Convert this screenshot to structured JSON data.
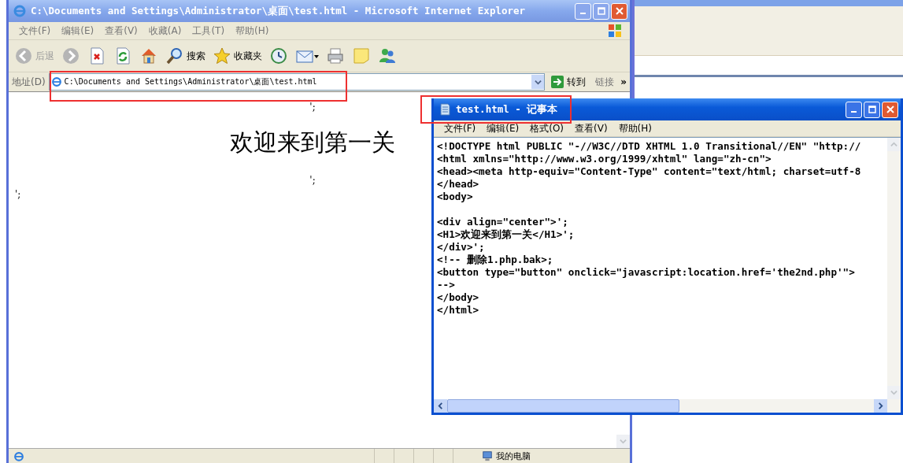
{
  "browser": {
    "title": "C:\\Documents and Settings\\Administrator\\桌面\\test.html - Microsoft Internet Explorer",
    "menu": [
      "文件(F)",
      "编辑(E)",
      "查看(V)",
      "收藏(A)",
      "工具(T)",
      "帮助(H)"
    ],
    "toolbar": [
      {
        "kind": "back",
        "label": "后退",
        "disabled": true
      },
      {
        "kind": "forward",
        "disabled": true
      },
      {
        "kind": "stop"
      },
      {
        "kind": "refresh"
      },
      {
        "kind": "home"
      },
      {
        "kind": "search",
        "label": "搜索"
      },
      {
        "kind": "favorites",
        "label": "收藏夹"
      },
      {
        "kind": "history"
      },
      {
        "kind": "mail"
      },
      {
        "kind": "print"
      },
      {
        "kind": "note"
      },
      {
        "kind": "messenger"
      }
    ],
    "address_label": "地址(D)",
    "address": "C:\\Documents and Settings\\Administrator\\桌面\\test.html",
    "go": "转到",
    "links": "链接",
    "more": "»",
    "page": [
      {
        "kind": "text",
        "text": "';"
      },
      {
        "kind": "heading",
        "text": "欢迎来到第一关"
      },
      {
        "kind": "text",
        "text": "';"
      },
      {
        "kind": "left",
        "text": "';"
      }
    ],
    "status_zone": "我的电脑"
  },
  "notepad": {
    "title": "test.html - 记事本",
    "menu": [
      "文件(F)",
      "编辑(E)",
      "格式(O)",
      "查看(V)",
      "帮助(H)"
    ],
    "paragraphs": [
      [
        "<!DOCTYPE html PUBLIC \"-//W3C//DTD XHTML 1.0 Transitional//EN\" \"http://",
        "<html xmlns=\"http://www.w3.org/1999/xhtml\" lang=\"zh-cn\">",
        "<head><meta http-equiv=\"Content-Type\" content=\"text/html; charset=utf-8",
        "</head>",
        "<body>"
      ],
      [
        "<div align=\"center\">';",
        "<H1>欢迎来到第一关</H1>';",
        "</div>';",
        "<!-- 删除1.php.bak>;",
        "<button type=\"button\" onclick=\"javascript:location.href='the2nd.php'\">",
        "-->",
        "</body>",
        "</html>"
      ]
    ]
  }
}
